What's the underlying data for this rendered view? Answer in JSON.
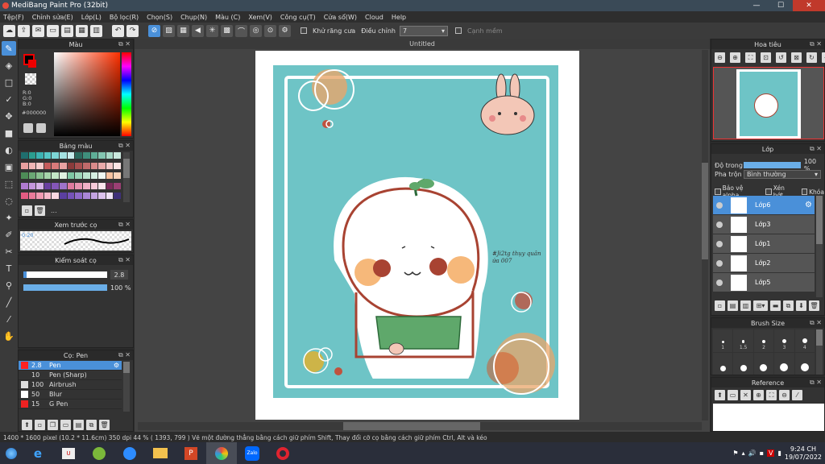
{
  "title": "MediBang Paint Pro (32bit)",
  "menu": [
    "Tệp(F)",
    "Chỉnh sửa(E)",
    "Lớp(L)",
    "Bộ lọc(R)",
    "Chọn(S)",
    "Chụp(N)",
    "Màu (C)",
    "Xem(V)",
    "Công cụ(T)",
    "Cửa sổ(W)",
    "Cloud",
    "Help"
  ],
  "toolbar": {
    "antialias_label": "Khử răng cưa",
    "adjust_label": "Điều chỉnh",
    "adjust_value": "7",
    "snap_label": "Cạnh mềm"
  },
  "color_panel": {
    "title": "Màu",
    "r": "R:0",
    "g": "G:0",
    "b": "B:0",
    "hex": "#000000"
  },
  "palette_panel": {
    "title": "Bảng màu",
    "more": "..."
  },
  "brush_preview": {
    "title": "Xem trước cọ",
    "size": "0.20"
  },
  "brush_control": {
    "title": "Kiểm soát cọ",
    "size_value": "2.8",
    "opacity_value": "100 %",
    "opacity_fraction": 1.0
  },
  "brush_list": {
    "title": "Cọ: Pen",
    "items": [
      {
        "size": "2.8",
        "name": "Pen",
        "color": "#ff2222"
      },
      {
        "size": "10",
        "name": "Pen (Sharp)",
        "color": "#333333"
      },
      {
        "size": "100",
        "name": "Airbrush",
        "color": "#dddddd"
      },
      {
        "size": "50",
        "name": "Blur",
        "color": "#ffffff"
      },
      {
        "size": "15",
        "name": "G Pen",
        "color": "#ee2222"
      }
    ]
  },
  "document": {
    "tab": "Untitled",
    "signature": "#Ji2tg thụy quân ứa 007"
  },
  "navigator": {
    "title": "Hoa tiêu"
  },
  "layers": {
    "title": "Lớp",
    "opacity_label": "Độ trong",
    "opacity_value": "100 %",
    "opacity_fraction": 1.0,
    "blend_label": "Pha trộn",
    "blend_value": "Bình thường",
    "protect_alpha": "Bảo vệ alpha",
    "clipping": "Xén bớt",
    "lock": "Khóa",
    "items": [
      "Lớp6",
      "Lớp3",
      "Lớp1",
      "Lớp2",
      "Lớp5"
    ]
  },
  "brush_size": {
    "title": "Brush Size",
    "labels": [
      "1",
      "1.5",
      "2",
      "3",
      "4"
    ]
  },
  "reference": {
    "title": "Reference"
  },
  "status": "1400 * 1600 pixel  (10.2 * 11.6cm)  350 dpi  44 %  ( 1393, 799 )  Vẽ một đường thẳng bằng cách giữ phím Shift, Thay đổi cỡ cọ bằng cách giữ phím Ctrl, Alt và kéo",
  "taskbar": {
    "time": "9:24 CH",
    "date": "19/07/2022",
    "apps": [
      "IE",
      "Unikey",
      "Tool",
      "Zoom",
      "Folder",
      "PowerPoint",
      "MediBang",
      "Zalo",
      "Opera"
    ],
    "zalo_label": "Zalo"
  },
  "colors": {
    "accent": "#4a90d9",
    "canvas_bg": "#6ec4c6",
    "foreground": "#000000",
    "background": "#ffffff"
  }
}
